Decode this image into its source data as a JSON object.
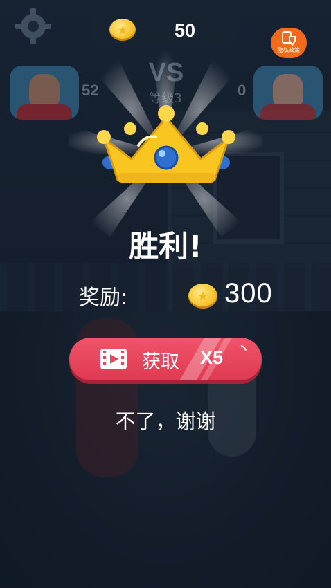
{
  "hud": {
    "coins": "50",
    "privacy_label": "隐私政策"
  },
  "match": {
    "vs": "VS",
    "level": "等级3",
    "left_score": "52",
    "right_score": "0"
  },
  "result": {
    "title": "胜利!",
    "reward_label": "奖励:",
    "reward_amount": "300"
  },
  "actions": {
    "claim_label": "获取",
    "claim_multiplier": "X5",
    "decline_label": "不了，谢谢"
  },
  "icons": {
    "coin": "coin-icon",
    "crown": "crown-icon",
    "video": "video-ad-icon",
    "settings": "gear-icon",
    "privacy": "privacy-policy-icon"
  },
  "colors": {
    "claim_button": "#e8475d",
    "privacy_badge": "#f26b1d",
    "coin": "#f8c531",
    "crown_gold": "#f9c521",
    "crown_gem": "#2e6fd1"
  }
}
